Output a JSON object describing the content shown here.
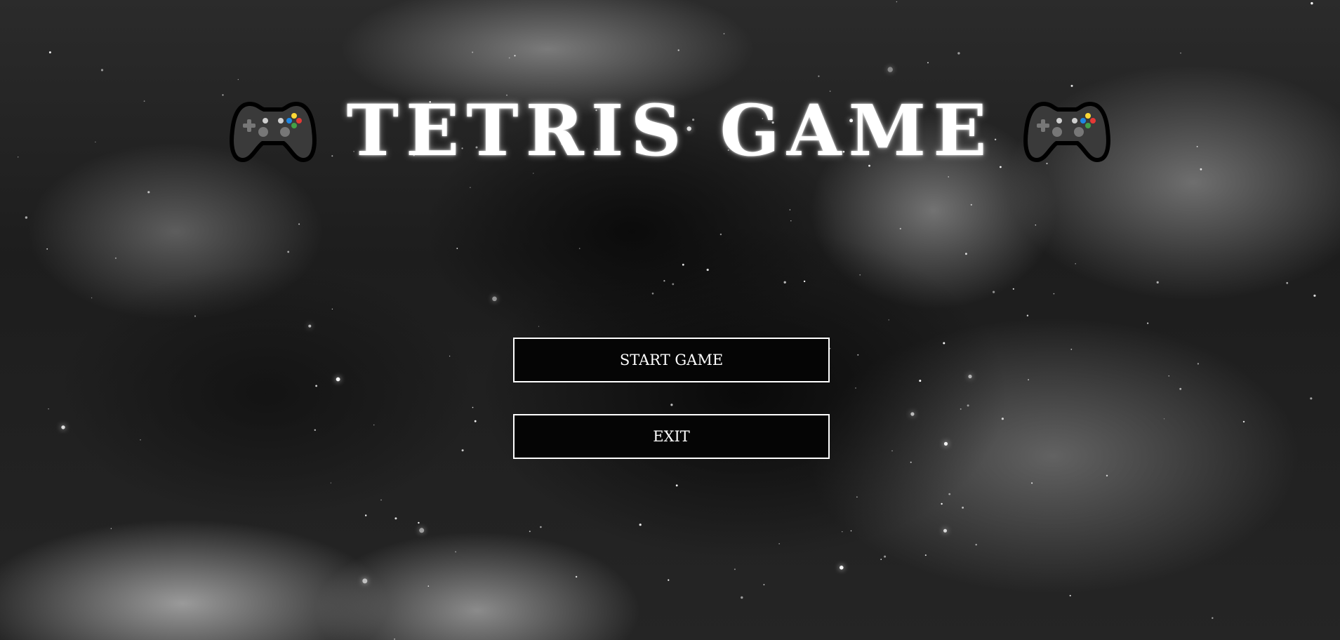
{
  "game": {
    "title": "TETRIS GAME",
    "title_icon": "gamepad-icon"
  },
  "menu": {
    "start_label": "START GAME",
    "exit_label": "EXIT"
  },
  "colors": {
    "text": "#ffffff",
    "button_background": "#050505",
    "button_border": "#ffffff",
    "controller_body": "#3a3a3a",
    "controller_outline": "#000000",
    "controller_button_red": "#e53935",
    "controller_button_green": "#43a047",
    "controller_button_blue": "#1e88e5",
    "controller_button_yellow": "#fdd835"
  }
}
